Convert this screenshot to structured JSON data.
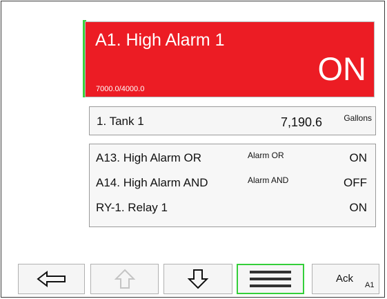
{
  "alarm": {
    "title": "A1. High Alarm 1",
    "status": "ON",
    "setpoint_reading": "7000.0/4000.0",
    "colors": {
      "background": "#ec1c24",
      "accent": "#39d33e",
      "text": "#ffffff"
    }
  },
  "tank": {
    "name": "1. Tank 1",
    "value": "7,190.6",
    "unit": "Gallons"
  },
  "outputs": [
    {
      "name": "A13. High Alarm OR",
      "tag": "Alarm OR",
      "state": "ON"
    },
    {
      "name": "A14. High Alarm AND",
      "tag": "Alarm AND",
      "state": "OFF"
    },
    {
      "name": "RY-1. Relay 1",
      "tag": "",
      "state": "ON"
    }
  ],
  "toolbar": {
    "back_icon": "left-arrow-icon",
    "up_icon": "up-arrow-icon",
    "down_icon": "down-arrow-icon",
    "menu_icon": "hamburger-menu-icon",
    "ack_label": "Ack",
    "ack_target": "A1",
    "menu_highlight_color": "#34cf3a"
  }
}
